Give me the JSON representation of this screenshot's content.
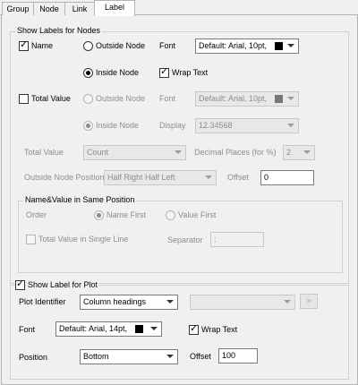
{
  "tabs": [
    "Group",
    "Node",
    "Link",
    "Label"
  ],
  "nodes_group": {
    "title": "Show Labels for Nodes",
    "name_label": "Name",
    "name_checked": true,
    "outside_node": "Outside Node",
    "inside_node": "Inside Node",
    "font_label": "Font",
    "font_value": "Default: Arial, 10pt,",
    "wrap_text": "Wrap Text",
    "wrap_checked": true,
    "total_value_label": "Total Value",
    "total_value_checked": false,
    "tv_outside_node": "Outside Node",
    "tv_inside_node": "Inside Node",
    "tv_font_label": "Font",
    "tv_font_value": "Default: Arial, 10pt,",
    "display_label": "Display",
    "display_value": "12.34568",
    "total_value_row_label": "Total Value",
    "total_value_combo": "Count",
    "decimal_label": "Decimal Places (for %)",
    "decimal_value": "2",
    "outside_pos_label": "Outside Node Position",
    "outside_pos_value": "Half Right Half Left",
    "offset_label": "Offset",
    "offset_value": "0"
  },
  "same_pos_group": {
    "title": "Name&Value in Same Position",
    "order_label": "Order",
    "name_first": "Name First",
    "value_first": "Value First",
    "single_line": "Total Value in Single Line",
    "separator_label": "Separator",
    "separator_value": ":"
  },
  "plot_group": {
    "title": "Show Label for Plot",
    "checked": true,
    "identifier_label": "Plot Identifier",
    "identifier_value": "Column headings",
    "identifier_extra": "",
    "browse_button": ">",
    "font_label": "Font",
    "font_value": "Default: Arial, 14pt,",
    "wrap_text": "Wrap Text",
    "wrap_checked": true,
    "position_label": "Position",
    "position_value": "Bottom",
    "offset_label": "Offset",
    "offset_value": "100"
  }
}
